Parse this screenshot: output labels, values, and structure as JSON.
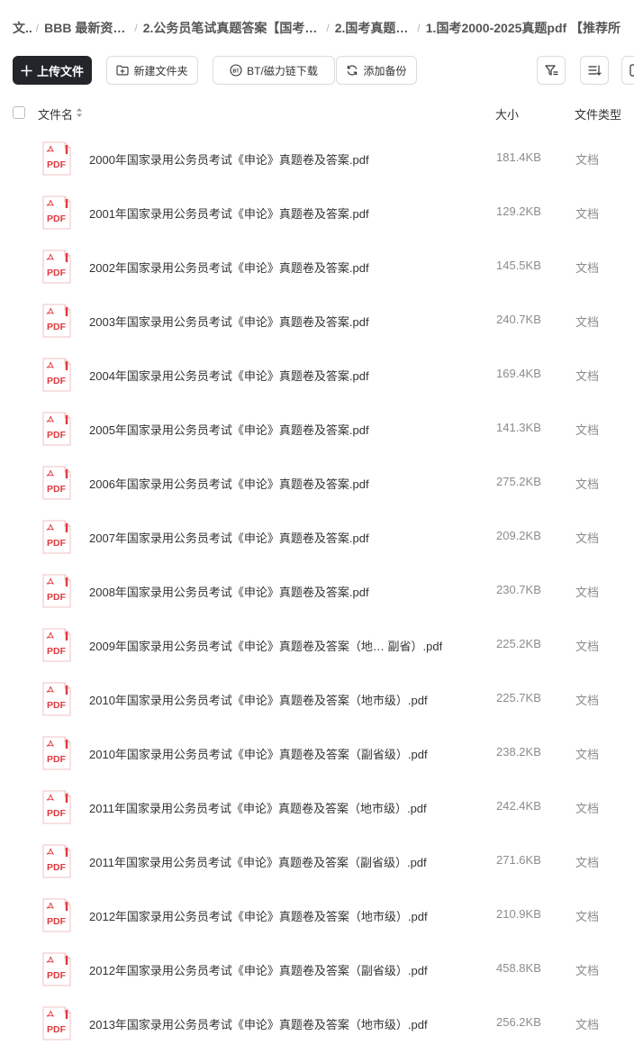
{
  "breadcrumb": [
    "文..",
    "BBB 最新资…",
    "2.公务员笔试真题答案【国考…",
    "2.国考真题…",
    "1.国考2000-2025真题pdf 【推荐所"
  ],
  "toolbar": {
    "upload": "上传文件",
    "new_folder": "新建文件夹",
    "bt_download": "BT/磁力链下载",
    "add_backup": "添加备份"
  },
  "table": {
    "columns": {
      "name": "文件名",
      "size": "大小",
      "type": "文件类型"
    },
    "rows": [
      {
        "name": "2000年国家录用公务员考试《申论》真题卷及答案.pdf",
        "size": "181.4KB",
        "type": "文档",
        "icon": "pdf-icon"
      },
      {
        "name": "2001年国家录用公务员考试《申论》真题卷及答案.pdf",
        "size": "129.2KB",
        "type": "文档",
        "icon": "pdf-icon"
      },
      {
        "name": "2002年国家录用公务员考试《申论》真题卷及答案.pdf",
        "size": "145.5KB",
        "type": "文档",
        "icon": "pdf-icon"
      },
      {
        "name": "2003年国家录用公务员考试《申论》真题卷及答案.pdf",
        "size": "240.7KB",
        "type": "文档",
        "icon": "pdf-icon"
      },
      {
        "name": "2004年国家录用公务员考试《申论》真题卷及答案.pdf",
        "size": "169.4KB",
        "type": "文档",
        "icon": "pdf-icon"
      },
      {
        "name": "2005年国家录用公务员考试《申论》真题卷及答案.pdf",
        "size": "141.3KB",
        "type": "文档",
        "icon": "pdf-icon"
      },
      {
        "name": "2006年国家录用公务员考试《申论》真题卷及答案.pdf",
        "size": "275.2KB",
        "type": "文档",
        "icon": "pdf-icon"
      },
      {
        "name": "2007年国家录用公务员考试《申论》真题卷及答案.pdf",
        "size": "209.2KB",
        "type": "文档",
        "icon": "pdf-icon"
      },
      {
        "name": "2008年国家录用公务员考试《申论》真题卷及答案.pdf",
        "size": "230.7KB",
        "type": "文档",
        "icon": "pdf-icon"
      },
      {
        "name": "2009年国家录用公务员考试《申论》真题卷及答案（地… 副省）.pdf",
        "size": "225.2KB",
        "type": "文档",
        "icon": "pdf-icon"
      },
      {
        "name": "2010年国家录用公务员考试《申论》真题卷及答案（地市级）.pdf",
        "size": "225.7KB",
        "type": "文档",
        "icon": "pdf-icon"
      },
      {
        "name": "2010年国家录用公务员考试《申论》真题卷及答案（副省级）.pdf",
        "size": "238.2KB",
        "type": "文档",
        "icon": "pdf-icon"
      },
      {
        "name": "2011年国家录用公务员考试《申论》真题卷及答案（地市级）.pdf",
        "size": "242.4KB",
        "type": "文档",
        "icon": "pdf-icon"
      },
      {
        "name": "2011年国家录用公务员考试《申论》真题卷及答案（副省级）.pdf",
        "size": "271.6KB",
        "type": "文档",
        "icon": "pdf-icon"
      },
      {
        "name": "2012年国家录用公务员考试《申论》真题卷及答案（地市级）.pdf",
        "size": "210.9KB",
        "type": "文档",
        "icon": "pdf-icon"
      },
      {
        "name": "2012年国家录用公务员考试《申论》真题卷及答案（副省级）.pdf",
        "size": "458.8KB",
        "type": "文档",
        "icon": "pdf-icon"
      },
      {
        "name": "2013年国家录用公务员考试《申论》真题卷及答案（地市级）.pdf",
        "size": "256.2KB",
        "type": "文档",
        "icon": "pdf-icon"
      }
    ]
  },
  "colors": {
    "primary_button": "#23252b",
    "pdf_red": "#e0393e",
    "muted_text": "#8c8c8c"
  }
}
